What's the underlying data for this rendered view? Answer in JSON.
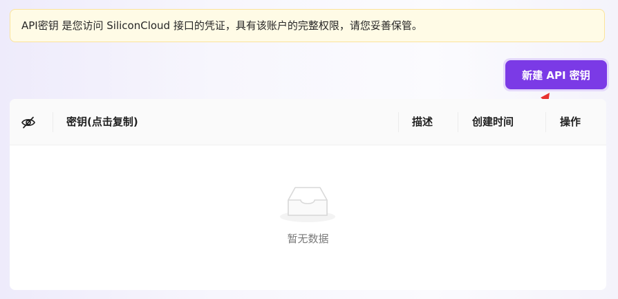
{
  "notice": {
    "text": "API密钥 是您访问 SiliconCloud 接口的凭证，具有该账户的完整权限，请您妥善保管。"
  },
  "toolbar": {
    "new_key_label": "新建 API 密钥"
  },
  "table": {
    "columns": {
      "visibility_icon": "eye-slash-icon",
      "key": "密钥(点击复制)",
      "description": "描述",
      "created_at": "创建时间",
      "actions": "操作"
    },
    "rows": [],
    "empty_text": "暂无数据"
  },
  "colors": {
    "accent": "#7b3ae6",
    "notice_bg": "#fffbe6",
    "annotation_arrow": "#e8312f"
  }
}
